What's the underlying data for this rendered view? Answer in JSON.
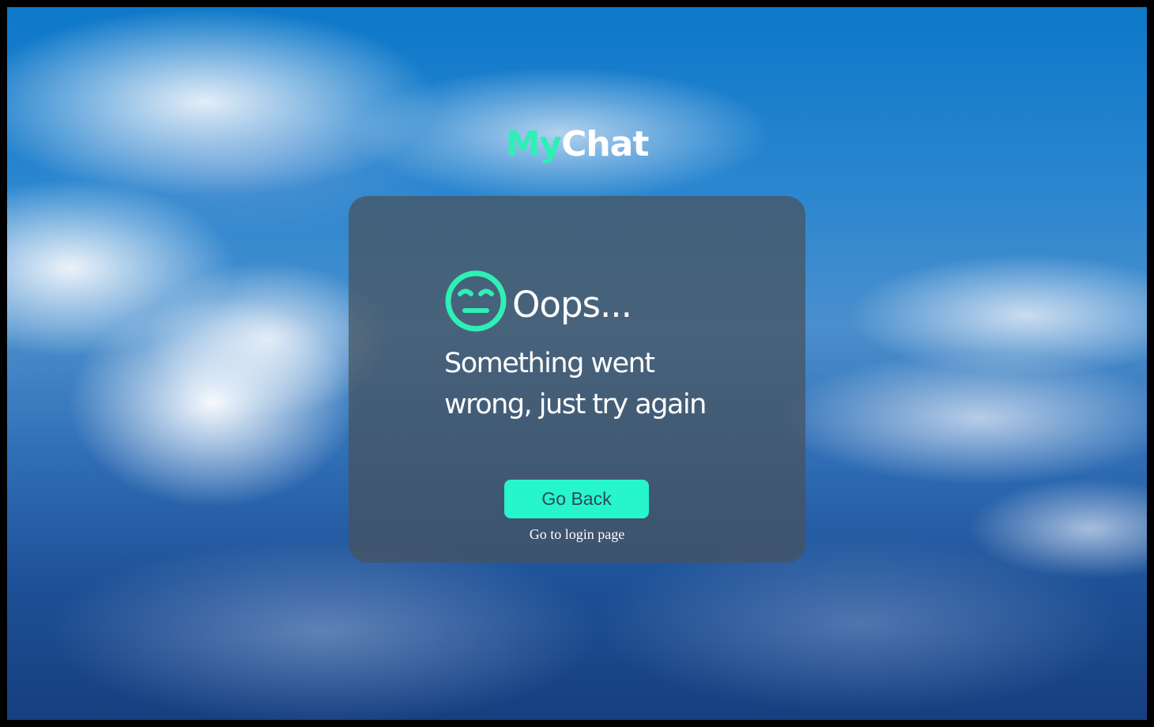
{
  "brand": {
    "part1": "My",
    "part2": "Chat",
    "accent_color": "#2ef0b4"
  },
  "error_card": {
    "icon": "neutral-face-icon",
    "heading": "Oops...",
    "message": "Something went wrong, just try again"
  },
  "actions": {
    "go_back_label": "Go Back",
    "go_back_color": "#27f5cc",
    "login_link_label": "Go to login page"
  }
}
